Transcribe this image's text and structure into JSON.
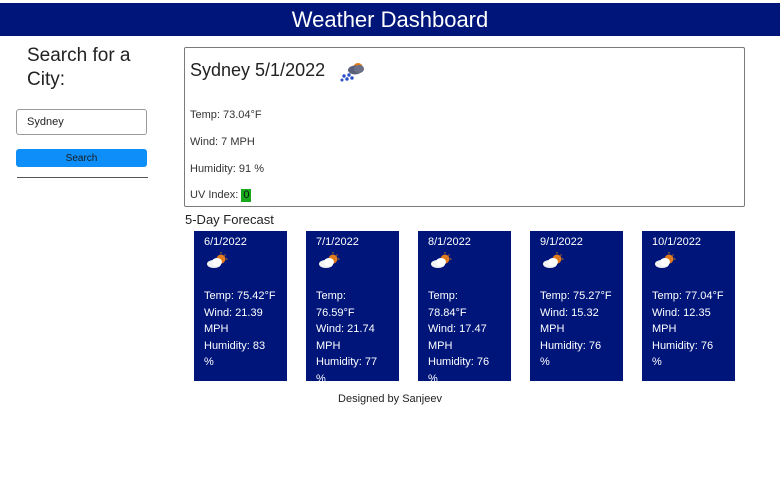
{
  "header": {
    "title": "Weather Dashboard",
    "background_color": "#00157a"
  },
  "sidebar": {
    "title": "Search for a City:",
    "search_value": "Sydney",
    "search_button_label": "Search",
    "search_button_color": "#0d8ef8"
  },
  "current": {
    "title": "Sydney 5/1/2022",
    "icon": "cloud-rain-sun-icon",
    "temp": "Temp: 73.04°F",
    "wind": "Wind: 7 MPH",
    "humidity": "Humidity: 91 %",
    "uv_label": "UV Index: ",
    "uv_value": "0",
    "uv_color": "#17a81e"
  },
  "forecast": {
    "heading": "5-Day Forecast",
    "days": [
      {
        "date": "6/1/2022",
        "icon": "cloud-sun-icon",
        "lines": [
          "Temp: 75.42°F",
          "Wind: 21.39",
          "MPH",
          "Humidity: 83",
          "%"
        ]
      },
      {
        "date": "7/1/2022",
        "icon": "cloud-sun-icon",
        "lines": [
          "Temp:",
          "76.59°F",
          "Wind: 21.74",
          "MPH",
          "Humidity: 77",
          "%"
        ]
      },
      {
        "date": "8/1/2022",
        "icon": "cloud-sun-icon",
        "lines": [
          "Temp:",
          "78.84°F",
          "Wind: 17.47",
          "MPH",
          "Humidity: 76",
          "%"
        ]
      },
      {
        "date": "9/1/2022",
        "icon": "cloud-sun-icon",
        "lines": [
          "Temp: 75.27°F",
          "Wind: 15.32",
          "MPH",
          "Humidity: 76",
          "%"
        ]
      },
      {
        "date": "10/1/2022",
        "icon": "cloud-sun-icon",
        "lines": [
          "Temp: 77.04°F",
          "Wind: 12.35",
          "MPH",
          "Humidity: 76",
          "%"
        ]
      }
    ]
  },
  "footer": {
    "text": "Designed by Sanjeev"
  }
}
